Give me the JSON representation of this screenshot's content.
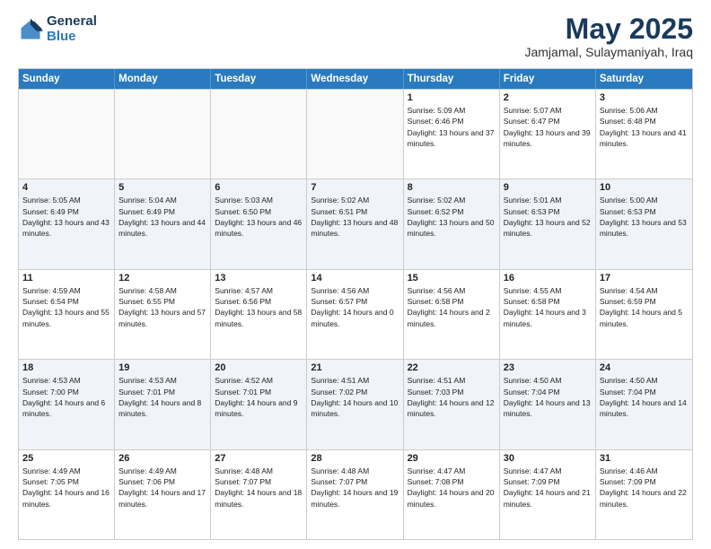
{
  "logo": {
    "general": "General",
    "blue": "Blue"
  },
  "header": {
    "month_year": "May 2025",
    "location": "Jamjamal, Sulaymaniyah, Iraq"
  },
  "days_of_week": [
    "Sunday",
    "Monday",
    "Tuesday",
    "Wednesday",
    "Thursday",
    "Friday",
    "Saturday"
  ],
  "weeks": [
    [
      {
        "day": "",
        "empty": true
      },
      {
        "day": "",
        "empty": true
      },
      {
        "day": "",
        "empty": true
      },
      {
        "day": "",
        "empty": true
      },
      {
        "day": "1",
        "sunrise": "Sunrise: 5:09 AM",
        "sunset": "Sunset: 6:46 PM",
        "daylight": "Daylight: 13 hours and 37 minutes."
      },
      {
        "day": "2",
        "sunrise": "Sunrise: 5:07 AM",
        "sunset": "Sunset: 6:47 PM",
        "daylight": "Daylight: 13 hours and 39 minutes."
      },
      {
        "day": "3",
        "sunrise": "Sunrise: 5:06 AM",
        "sunset": "Sunset: 6:48 PM",
        "daylight": "Daylight: 13 hours and 41 minutes."
      }
    ],
    [
      {
        "day": "4",
        "sunrise": "Sunrise: 5:05 AM",
        "sunset": "Sunset: 6:49 PM",
        "daylight": "Daylight: 13 hours and 43 minutes."
      },
      {
        "day": "5",
        "sunrise": "Sunrise: 5:04 AM",
        "sunset": "Sunset: 6:49 PM",
        "daylight": "Daylight: 13 hours and 44 minutes."
      },
      {
        "day": "6",
        "sunrise": "Sunrise: 5:03 AM",
        "sunset": "Sunset: 6:50 PM",
        "daylight": "Daylight: 13 hours and 46 minutes."
      },
      {
        "day": "7",
        "sunrise": "Sunrise: 5:02 AM",
        "sunset": "Sunset: 6:51 PM",
        "daylight": "Daylight: 13 hours and 48 minutes."
      },
      {
        "day": "8",
        "sunrise": "Sunrise: 5:02 AM",
        "sunset": "Sunset: 6:52 PM",
        "daylight": "Daylight: 13 hours and 50 minutes."
      },
      {
        "day": "9",
        "sunrise": "Sunrise: 5:01 AM",
        "sunset": "Sunset: 6:53 PM",
        "daylight": "Daylight: 13 hours and 52 minutes."
      },
      {
        "day": "10",
        "sunrise": "Sunrise: 5:00 AM",
        "sunset": "Sunset: 6:53 PM",
        "daylight": "Daylight: 13 hours and 53 minutes."
      }
    ],
    [
      {
        "day": "11",
        "sunrise": "Sunrise: 4:59 AM",
        "sunset": "Sunset: 6:54 PM",
        "daylight": "Daylight: 13 hours and 55 minutes."
      },
      {
        "day": "12",
        "sunrise": "Sunrise: 4:58 AM",
        "sunset": "Sunset: 6:55 PM",
        "daylight": "Daylight: 13 hours and 57 minutes."
      },
      {
        "day": "13",
        "sunrise": "Sunrise: 4:57 AM",
        "sunset": "Sunset: 6:56 PM",
        "daylight": "Daylight: 13 hours and 58 minutes."
      },
      {
        "day": "14",
        "sunrise": "Sunrise: 4:56 AM",
        "sunset": "Sunset: 6:57 PM",
        "daylight": "Daylight: 14 hours and 0 minutes."
      },
      {
        "day": "15",
        "sunrise": "Sunrise: 4:56 AM",
        "sunset": "Sunset: 6:58 PM",
        "daylight": "Daylight: 14 hours and 2 minutes."
      },
      {
        "day": "16",
        "sunrise": "Sunrise: 4:55 AM",
        "sunset": "Sunset: 6:58 PM",
        "daylight": "Daylight: 14 hours and 3 minutes."
      },
      {
        "day": "17",
        "sunrise": "Sunrise: 4:54 AM",
        "sunset": "Sunset: 6:59 PM",
        "daylight": "Daylight: 14 hours and 5 minutes."
      }
    ],
    [
      {
        "day": "18",
        "sunrise": "Sunrise: 4:53 AM",
        "sunset": "Sunset: 7:00 PM",
        "daylight": "Daylight: 14 hours and 6 minutes."
      },
      {
        "day": "19",
        "sunrise": "Sunrise: 4:53 AM",
        "sunset": "Sunset: 7:01 PM",
        "daylight": "Daylight: 14 hours and 8 minutes."
      },
      {
        "day": "20",
        "sunrise": "Sunrise: 4:52 AM",
        "sunset": "Sunset: 7:01 PM",
        "daylight": "Daylight: 14 hours and 9 minutes."
      },
      {
        "day": "21",
        "sunrise": "Sunrise: 4:51 AM",
        "sunset": "Sunset: 7:02 PM",
        "daylight": "Daylight: 14 hours and 10 minutes."
      },
      {
        "day": "22",
        "sunrise": "Sunrise: 4:51 AM",
        "sunset": "Sunset: 7:03 PM",
        "daylight": "Daylight: 14 hours and 12 minutes."
      },
      {
        "day": "23",
        "sunrise": "Sunrise: 4:50 AM",
        "sunset": "Sunset: 7:04 PM",
        "daylight": "Daylight: 14 hours and 13 minutes."
      },
      {
        "day": "24",
        "sunrise": "Sunrise: 4:50 AM",
        "sunset": "Sunset: 7:04 PM",
        "daylight": "Daylight: 14 hours and 14 minutes."
      }
    ],
    [
      {
        "day": "25",
        "sunrise": "Sunrise: 4:49 AM",
        "sunset": "Sunset: 7:05 PM",
        "daylight": "Daylight: 14 hours and 16 minutes."
      },
      {
        "day": "26",
        "sunrise": "Sunrise: 4:49 AM",
        "sunset": "Sunset: 7:06 PM",
        "daylight": "Daylight: 14 hours and 17 minutes."
      },
      {
        "day": "27",
        "sunrise": "Sunrise: 4:48 AM",
        "sunset": "Sunset: 7:07 PM",
        "daylight": "Daylight: 14 hours and 18 minutes."
      },
      {
        "day": "28",
        "sunrise": "Sunrise: 4:48 AM",
        "sunset": "Sunset: 7:07 PM",
        "daylight": "Daylight: 14 hours and 19 minutes."
      },
      {
        "day": "29",
        "sunrise": "Sunrise: 4:47 AM",
        "sunset": "Sunset: 7:08 PM",
        "daylight": "Daylight: 14 hours and 20 minutes."
      },
      {
        "day": "30",
        "sunrise": "Sunrise: 4:47 AM",
        "sunset": "Sunset: 7:09 PM",
        "daylight": "Daylight: 14 hours and 21 minutes."
      },
      {
        "day": "31",
        "sunrise": "Sunrise: 4:46 AM",
        "sunset": "Sunset: 7:09 PM",
        "daylight": "Daylight: 14 hours and 22 minutes."
      }
    ]
  ]
}
